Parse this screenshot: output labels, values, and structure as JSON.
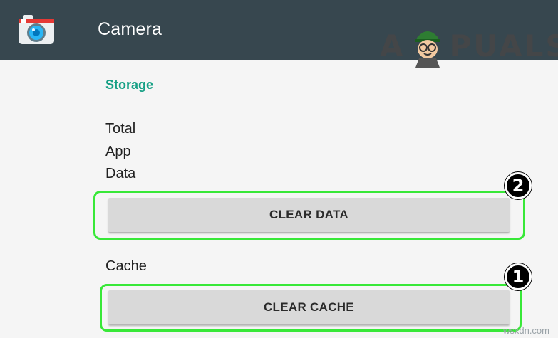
{
  "appbar": {
    "title": "Camera",
    "icon": "camera-icon",
    "background": "#37474f"
  },
  "watermark": {
    "text_left": "A",
    "text_right": "PUALS"
  },
  "storage": {
    "section_title": "Storage",
    "labels": [
      "Total",
      "App",
      "Data"
    ],
    "clear_data_label": "CLEAR DATA",
    "cache_label": "Cache",
    "clear_cache_label": "CLEAR CACHE"
  },
  "annotations": {
    "step_clear_data": "2",
    "step_clear_cache": "1",
    "highlight_color": "#38e838"
  },
  "footer": {
    "site": "wsxdn.com"
  }
}
